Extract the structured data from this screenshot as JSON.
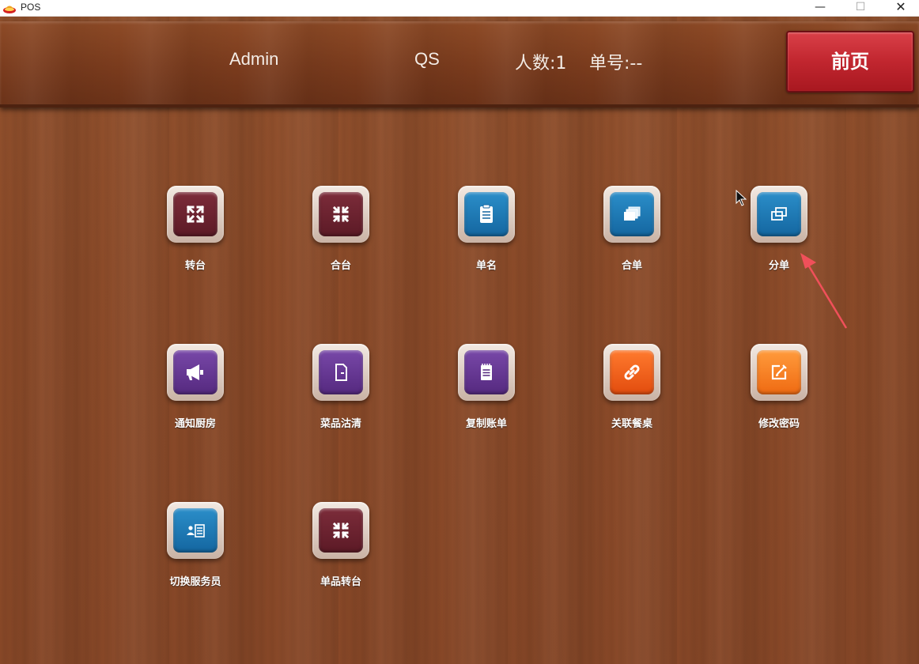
{
  "window": {
    "title": "POS",
    "minimize": "—",
    "maximize": "☐",
    "close": "✕"
  },
  "header": {
    "user": "Admin",
    "shop": "QS",
    "guests": "人数:1",
    "order_no": "单号:--",
    "front_button": "前页"
  },
  "tiles": [
    {
      "label": "转台",
      "icon": "expand-arrows-icon",
      "color": "#6a2230"
    },
    {
      "label": "合台",
      "icon": "collapse-arrows-icon",
      "color": "#6a2230"
    },
    {
      "label": "单名",
      "icon": "clipboard-icon",
      "color": "#1f7ab8"
    },
    {
      "label": "合单",
      "icon": "stacked-cards-icon",
      "color": "#1f7ab8"
    },
    {
      "label": "分单",
      "icon": "split-cards-icon",
      "color": "#1f7ab8"
    },
    {
      "label": "通知厨房",
      "icon": "megaphone-icon",
      "color": "#663796"
    },
    {
      "label": "菜品沽清",
      "icon": "blank-document-icon",
      "color": "#663796"
    },
    {
      "label": "复制账单",
      "icon": "notepad-icon",
      "color": "#663796"
    },
    {
      "label": "关联餐桌",
      "icon": "link-icon",
      "color": "#f05d1c"
    },
    {
      "label": "修改密码",
      "icon": "edit-icon",
      "color": "#f58024"
    },
    {
      "label": "切换服务员",
      "icon": "contact-card-icon",
      "color": "#1f7ab8"
    },
    {
      "label": "单品转台",
      "icon": "collapse-arrows-icon",
      "color": "#6a2230"
    }
  ]
}
